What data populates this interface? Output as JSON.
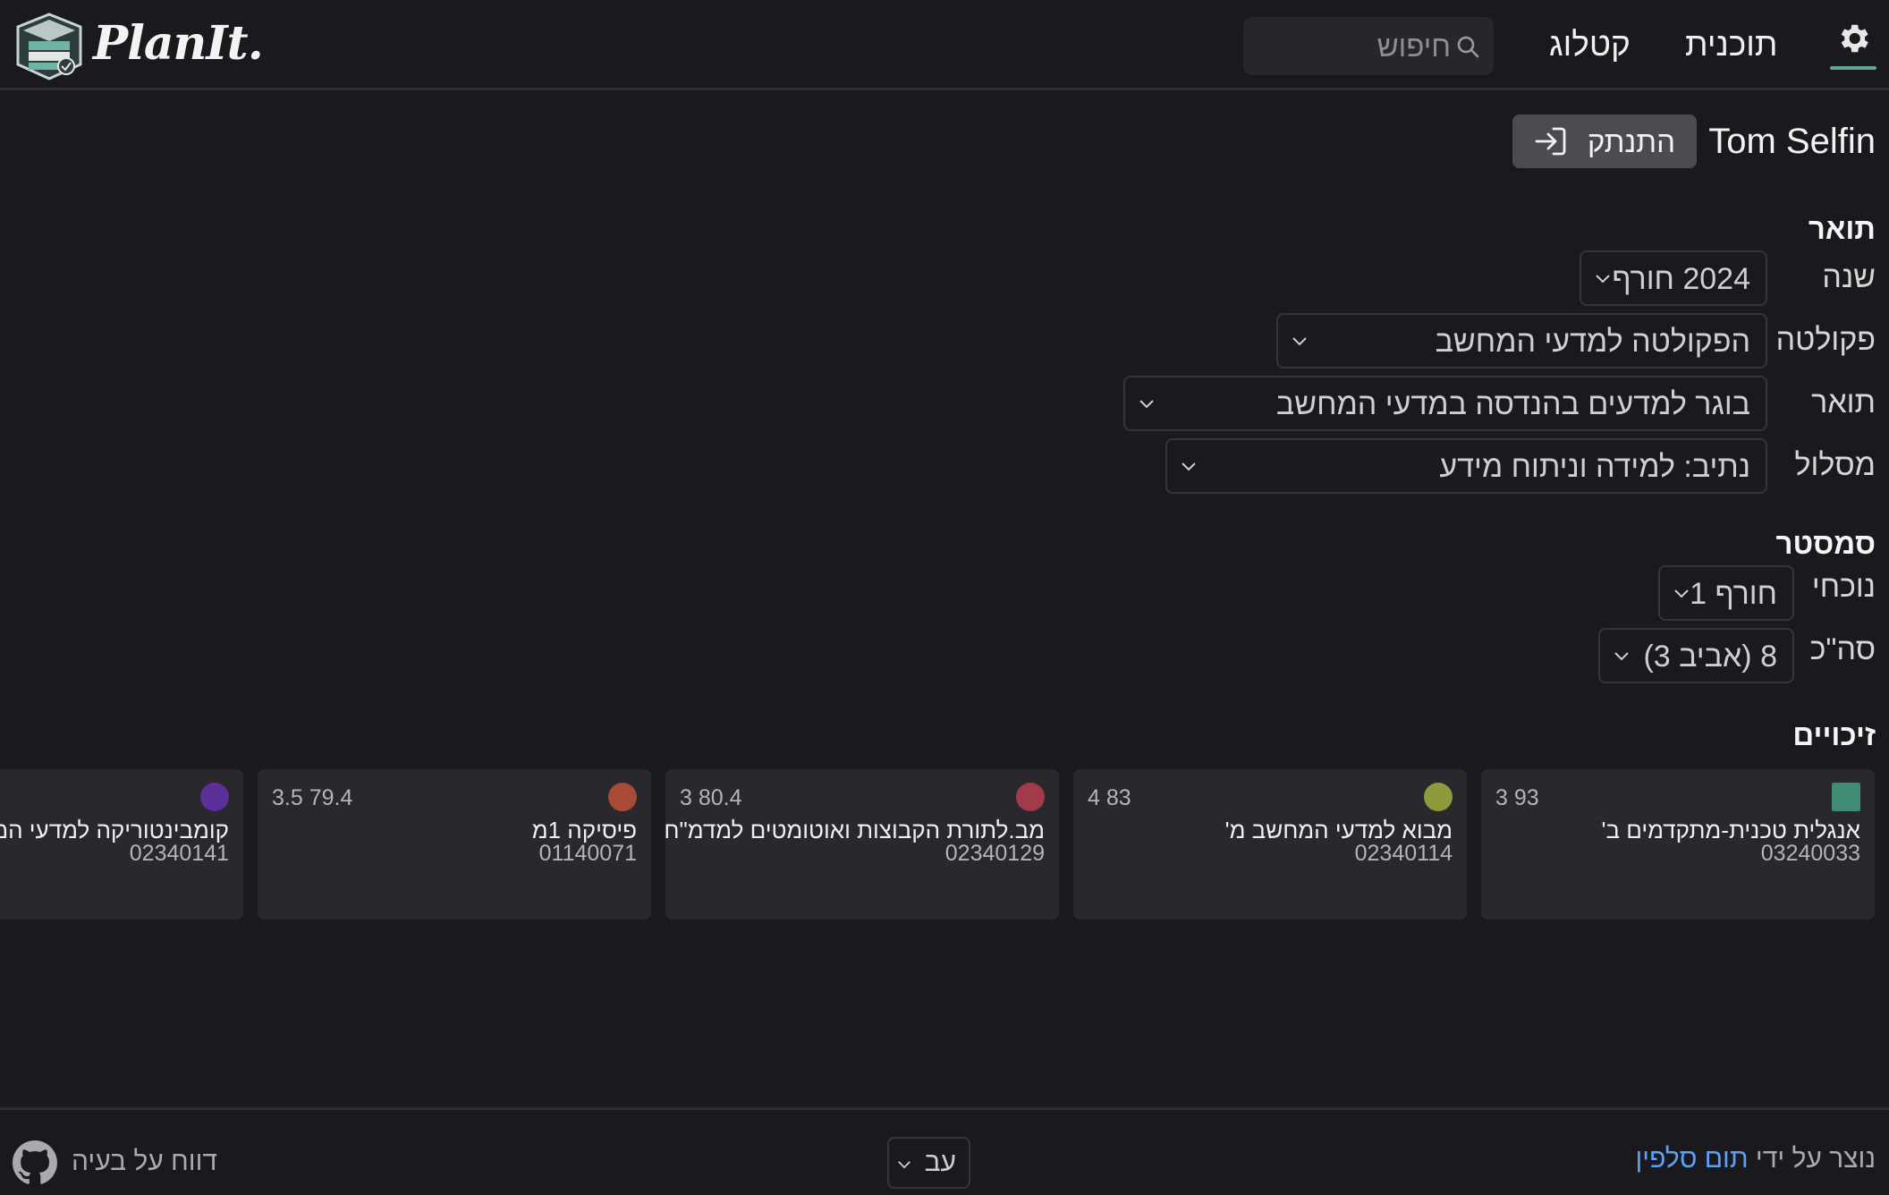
{
  "header": {
    "brand": "PlanIt.",
    "search_placeholder": "חיפוש",
    "nav": {
      "catalog": "קטלוג",
      "plan": "תוכנית"
    },
    "icons": {
      "settings": "gear-icon",
      "search": "search-icon"
    },
    "accent_color": "#5fa89a"
  },
  "user": {
    "name": "Tom Selfin",
    "logout_label": "התנתק"
  },
  "degree_section": {
    "title": "תואר",
    "fields": {
      "year": {
        "label": "שנה",
        "value": "2024 חורף"
      },
      "faculty": {
        "label": "פקולטה",
        "value": "הפקולטה למדעי המחשב"
      },
      "degree": {
        "label": "תואר",
        "value": "בוגר למדעים בהנדסה במדעי המחשב"
      },
      "track": {
        "label": "מסלול",
        "value": "נתיב: למידה וניתוח מידע"
      }
    }
  },
  "semester_section": {
    "title": "סמסטר",
    "fields": {
      "current": {
        "label": "נוכחי",
        "value": "חורף 1"
      },
      "total": {
        "label": "סה\"כ",
        "value": "8 (אביב 3)"
      }
    }
  },
  "credits_section": {
    "title": "זיכויים",
    "courses": [
      {
        "stats": "3 93",
        "name": "אנגלית טכנית-מתקדמים ב'",
        "code": "03240033",
        "color": "#3f8b73",
        "shape": "square"
      },
      {
        "stats": "4 83",
        "name": "מבוא למדעי המחשב מ'",
        "code": "02340114",
        "color": "#8f9a3c",
        "shape": "circle"
      },
      {
        "stats": "3 80.4",
        "name": "מב.לתורת הקבוצות ואוטומטים למדמ\"ח",
        "code": "02340129",
        "color": "#a23a4b",
        "shape": "circle"
      },
      {
        "stats": "3.5 79.4",
        "name": "פיסיקה 1מ",
        "code": "01140071",
        "color": "#a84a35",
        "shape": "circle"
      },
      {
        "stats": "",
        "name": "קומבינטוריקה למדעי המחשב",
        "code": "02340141",
        "color": "#5b2f98",
        "shape": "circle"
      }
    ]
  },
  "footer": {
    "credit_prefix": "נוצר על ידי",
    "credit_name": "תום סלפין",
    "language": "עב",
    "report_label": "דווח על בעיה",
    "icons": {
      "report": "github-icon"
    }
  }
}
